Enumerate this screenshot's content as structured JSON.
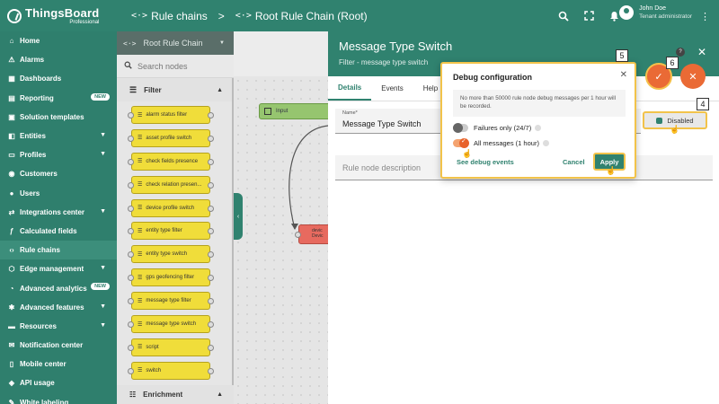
{
  "header": {
    "brand": "ThingsBoard",
    "brand_sub": "Professional",
    "breadcrumb": [
      {
        "icon": "code-icon",
        "label": "Rule chains"
      },
      {
        "icon": "code-icon",
        "label": "Root Rule Chain (Root)"
      }
    ],
    "breadcrumb_sep": ">",
    "icons": [
      "search-icon",
      "fullscreen-icon",
      "bell-icon"
    ],
    "user": {
      "name": "John Doe",
      "role": "Tenant administrator"
    }
  },
  "sidebar": {
    "items": [
      {
        "label": "Home",
        "icon": "home-icon"
      },
      {
        "label": "Alarms",
        "icon": "alarm-icon"
      },
      {
        "label": "Dashboards",
        "icon": "dashboard-icon"
      },
      {
        "label": "Reporting",
        "icon": "report-icon",
        "badge": "NEW"
      },
      {
        "label": "Solution templates",
        "icon": "template-icon"
      },
      {
        "label": "Entities",
        "icon": "entities-icon",
        "expandable": true
      },
      {
        "label": "Profiles",
        "icon": "profiles-icon",
        "expandable": true
      },
      {
        "label": "Customers",
        "icon": "customers-icon"
      },
      {
        "label": "Users",
        "icon": "users-icon"
      },
      {
        "label": "Integrations center",
        "icon": "integrations-icon",
        "expandable": true
      },
      {
        "label": "Calculated fields",
        "icon": "function-icon"
      },
      {
        "label": "Rule chains",
        "icon": "code-icon",
        "active": true
      },
      {
        "label": "Edge management",
        "icon": "edge-icon",
        "expandable": true
      },
      {
        "label": "Advanced analytics",
        "icon": "analytics-icon",
        "badge": "NEW"
      },
      {
        "label": "Advanced features",
        "icon": "features-icon",
        "expandable": true
      },
      {
        "label": "Resources",
        "icon": "folder-icon",
        "expandable": true
      },
      {
        "label": "Notification center",
        "icon": "notification-icon"
      },
      {
        "label": "Mobile center",
        "icon": "mobile-icon"
      },
      {
        "label": "API usage",
        "icon": "api-icon"
      },
      {
        "label": "White labeling",
        "icon": "palette-icon"
      }
    ]
  },
  "library": {
    "chain_select": "Root Rule Chain",
    "search_placeholder": "Search nodes",
    "section_filter": "Filter",
    "nodes": [
      "alarm status filter",
      "asset profile switch",
      "check fields presence",
      "check relation presen...",
      "device profile switch",
      "entity type filter",
      "entity type switch",
      "gps geofencing filter",
      "message type filter",
      "message type switch",
      "script",
      "switch"
    ],
    "section_enrichment": "Enrichment"
  },
  "canvas": {
    "input_label": "Input",
    "red_node_line1": "devic",
    "red_node_line2": "Devic"
  },
  "panel": {
    "title": "Message Type Switch",
    "subtitle": "Filter - message type switch",
    "tabs": [
      "Details",
      "Events",
      "Help"
    ],
    "name_label": "Name*",
    "name_value": "Message Type Switch",
    "description_placeholder": "Rule node description",
    "debug_button": "Disabled"
  },
  "popup": {
    "title": "Debug configuration",
    "note": "No more than 50000 rule node debug messages per 1 hour will be recorded.",
    "option1": "Failures only (24/7)",
    "option2": "All messages (1 hour)",
    "option1_on": false,
    "option2_on": true,
    "see_events": "See debug events",
    "cancel": "Cancel",
    "apply": "Apply"
  },
  "steps": {
    "s4": "4",
    "s5": "5",
    "s6": "6",
    "help": "?"
  },
  "colors": {
    "primary": "#30826f",
    "accent": "#ea6a35",
    "highlight": "#f2c34a",
    "node_filter": "#f0dd3a"
  }
}
